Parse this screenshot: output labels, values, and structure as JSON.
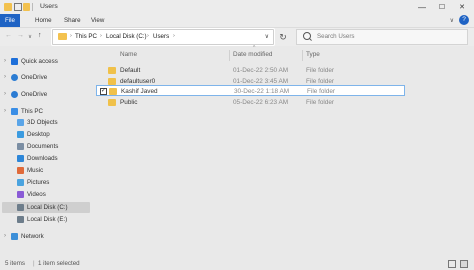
{
  "window": {
    "title": "Users",
    "minimize": "—",
    "maximize": "☐",
    "close": "✕"
  },
  "ribbon": {
    "tabs": [
      "File",
      "Home",
      "Share",
      "View"
    ],
    "expand": "∨",
    "help": "?"
  },
  "nav": {
    "back": "←",
    "forward": "→",
    "recent": "∨",
    "up": "↑",
    "breadcrumb": [
      "This PC",
      "Local Disk (C:)",
      "Users"
    ],
    "dropdown": "∨",
    "refresh": "↻",
    "search_placeholder": "Search Users"
  },
  "sidebar": {
    "items": [
      {
        "label": "Quick access",
        "icon": "star-icon",
        "color": "#1e6fd9"
      },
      {
        "label": "OneDrive",
        "icon": "cloud-icon",
        "color": "#2b7cd3"
      },
      {
        "label": "OneDrive",
        "icon": "cloud-icon",
        "color": "#2b7cd3"
      },
      {
        "label": "This PC",
        "icon": "computer-icon",
        "color": "#3a8ee6"
      },
      {
        "label": "3D Objects",
        "icon": "cube-icon",
        "color": "#5aa5e8"
      },
      {
        "label": "Desktop",
        "icon": "desktop-icon",
        "color": "#3b9be0"
      },
      {
        "label": "Documents",
        "icon": "documents-icon",
        "color": "#7b8ea3"
      },
      {
        "label": "Downloads",
        "icon": "downloads-icon",
        "color": "#2d86d8"
      },
      {
        "label": "Music",
        "icon": "music-icon",
        "color": "#e06a3a"
      },
      {
        "label": "Pictures",
        "icon": "pictures-icon",
        "color": "#4aa3df"
      },
      {
        "label": "Videos",
        "icon": "videos-icon",
        "color": "#8a5bd6"
      },
      {
        "label": "Local Disk (C:)",
        "icon": "drive-icon",
        "color": "#6d7d8b"
      },
      {
        "label": "Local Disk (E:)",
        "icon": "drive-icon",
        "color": "#6d7d8b"
      },
      {
        "label": "Network",
        "icon": "network-icon",
        "color": "#3c8fd8"
      }
    ]
  },
  "columns": {
    "name": "Name",
    "date": "Date modified",
    "type": "Type",
    "sort_indicator": "^"
  },
  "files": [
    {
      "name": "Default",
      "date": "01-Dec-22 2:50 AM",
      "type": "File folder"
    },
    {
      "name": "defaultuser0",
      "date": "01-Dec-22 3:45 AM",
      "type": "File folder"
    },
    {
      "name": "Kashif Javed",
      "date": "30-Dec-22 1:18 AM",
      "type": "File folder"
    },
    {
      "name": "Public",
      "date": "05-Dec-22 6:23 AM",
      "type": "File folder"
    }
  ],
  "selection_check": "✓",
  "status": {
    "items": "5 items",
    "selected": "1 item selected"
  },
  "colors": {
    "accent": "#1f63c4",
    "folder": "#f0c14a",
    "selection_border": "#7eb4ea"
  }
}
